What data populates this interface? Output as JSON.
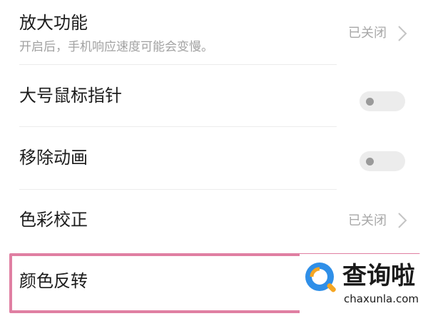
{
  "settings": {
    "magnify": {
      "title": "放大功能",
      "subtitle": "开启后，手机响应速度可能会变慢。",
      "status": "已关闭"
    },
    "large_pointer": {
      "title": "大号鼠标指针",
      "enabled": false
    },
    "remove_animation": {
      "title": "移除动画",
      "enabled": false
    },
    "color_correction": {
      "title": "色彩校正",
      "status": "已关闭"
    },
    "color_inversion": {
      "title": "颜色反转"
    }
  },
  "watermark": {
    "name_cn": "查询啦",
    "domain": "chaxunla.com"
  },
  "colors": {
    "highlight_border": "#e07fa2",
    "logo_blue": "#2f8fe8",
    "logo_orange": "#f5a623"
  }
}
